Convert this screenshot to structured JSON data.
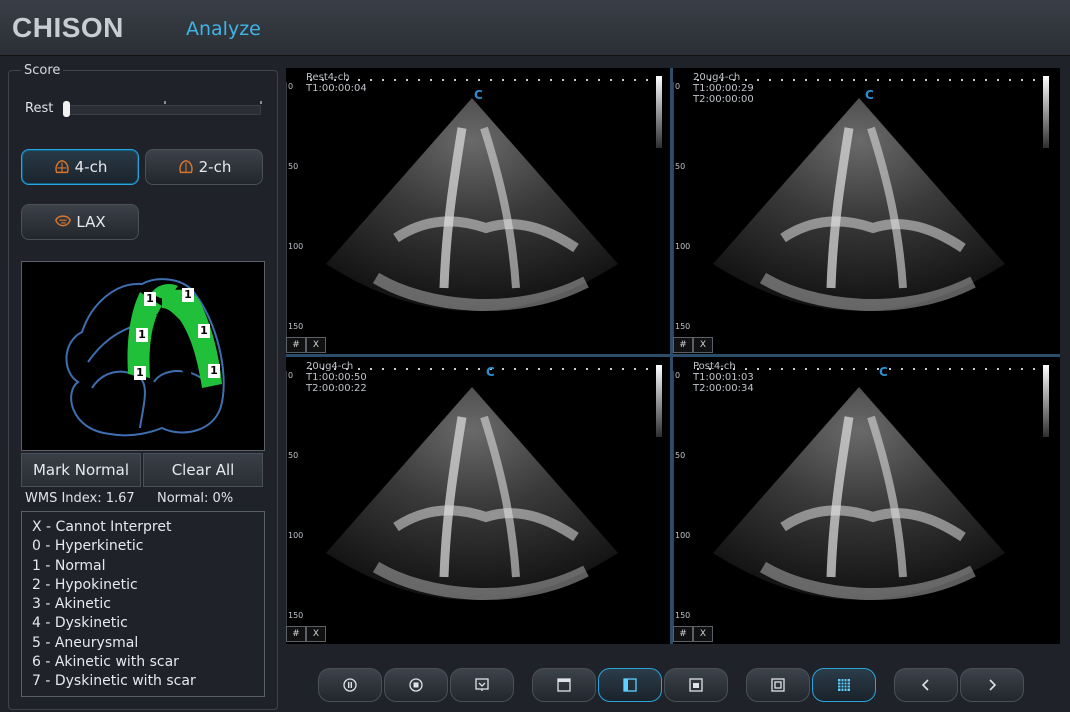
{
  "header": {
    "brand": "CHISON",
    "title": "Analyze"
  },
  "score": {
    "legend": "Score",
    "rest_label": "Rest",
    "views": [
      {
        "label": "4-ch",
        "active": true
      },
      {
        "label": "2-ch",
        "active": false
      },
      {
        "label": "LAX",
        "active": false
      }
    ],
    "segment_scores": [
      "1",
      "1",
      "1",
      "1",
      "1",
      "1"
    ],
    "mark_normal": "Mark Normal",
    "clear_all": "Clear All",
    "wms_index": "WMS Index:  1.67",
    "normal": "Normal:  0%",
    "legend_items": [
      "X - Cannot Interpret",
      "0 - Hyperkinetic",
      "1 - Normal",
      "2 - Hypokinetic",
      "3 - Akinetic",
      "4 - Dyskinetic",
      "5 - Aneurysmal",
      "6 - Akinetic with scar",
      "7 - Dyskinetic with scar"
    ]
  },
  "viewer": {
    "quads": [
      {
        "line1": "Rest4-ch",
        "line2": "T1:00:00:04",
        "line3": ""
      },
      {
        "line1": "20ug4-ch",
        "line2": "T1:00:00:29",
        "line3": "T2:00:00:00"
      },
      {
        "line1": "20ug4-ch",
        "line2": "T1:00:00:50",
        "line3": "T2:00:00:22"
      },
      {
        "line1": "Post4-ch",
        "line2": "T1:00:01:03",
        "line3": "T2:00:00:34"
      }
    ],
    "c_marker": "C",
    "depth_ticks": [
      "0",
      "50",
      "100",
      "150"
    ],
    "corner_buttons": [
      "#",
      "X"
    ]
  },
  "toolbar": {
    "buttons": [
      {
        "icon": "pause-icon",
        "active": false
      },
      {
        "icon": "stop-icon",
        "active": false
      },
      {
        "icon": "review-icon",
        "active": false
      },
      {
        "icon": "layout-header-icon",
        "active": false
      },
      {
        "icon": "layout-side-icon",
        "active": true
      },
      {
        "icon": "single-image-icon",
        "active": false
      },
      {
        "icon": "single-frame-icon",
        "active": false
      },
      {
        "icon": "quad-grid-icon",
        "active": true
      },
      {
        "icon": "previous-icon",
        "active": false
      },
      {
        "icon": "next-icon",
        "active": false
      }
    ]
  }
}
